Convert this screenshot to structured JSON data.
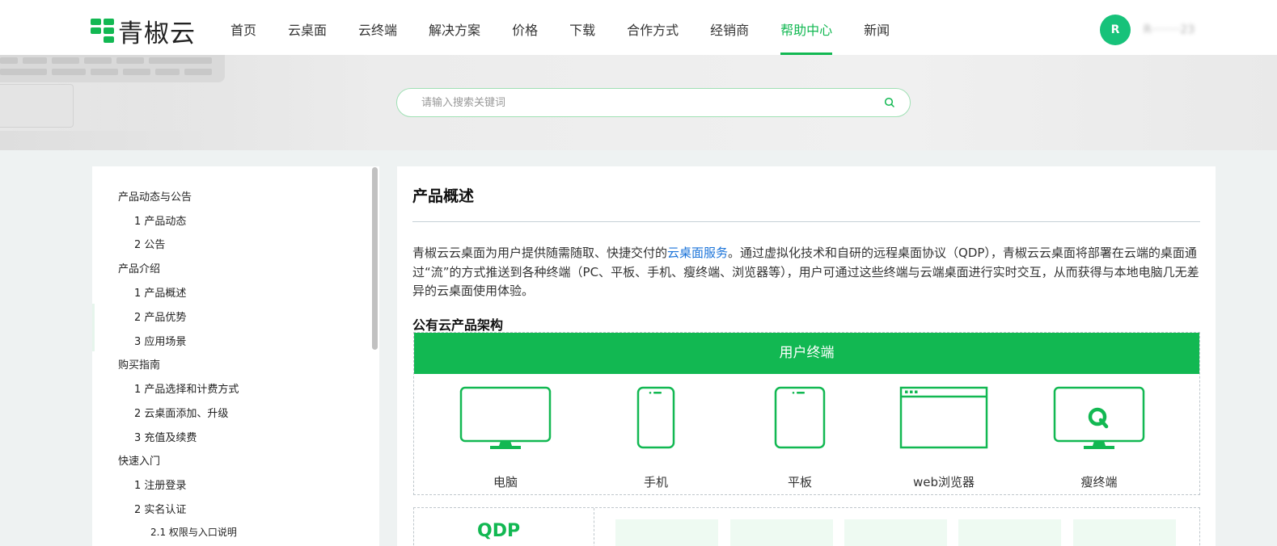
{
  "header": {
    "logo_text": "青椒云",
    "nav": [
      "首页",
      "云桌面",
      "云终端",
      "解决方案",
      "价格",
      "下载",
      "合作方式",
      "经销商",
      "帮助中心",
      "新闻"
    ],
    "active_nav": "帮助中心",
    "avatar_letter": "R",
    "username": "R········23"
  },
  "search": {
    "placeholder": "请输入搜索关键词"
  },
  "sidebar": {
    "items": [
      {
        "label": "产品动态与公告",
        "level": 1
      },
      {
        "label": "1 产品动态",
        "level": 2
      },
      {
        "label": "2 公告",
        "level": 2
      },
      {
        "label": "产品介绍",
        "level": 1
      },
      {
        "label": "1 产品概述",
        "level": 2
      },
      {
        "label": "2 产品优势",
        "level": 2
      },
      {
        "label": "3 应用场景",
        "level": 2
      },
      {
        "label": "购买指南",
        "level": 1
      },
      {
        "label": "1 产品选择和计费方式",
        "level": 2
      },
      {
        "label": "2 云桌面添加、升级",
        "level": 2
      },
      {
        "label": "3 充值及续费",
        "level": 2
      },
      {
        "label": "快速入门",
        "level": 1
      },
      {
        "label": "1 注册登录",
        "level": 2
      },
      {
        "label": "2 实名认证",
        "level": 2
      },
      {
        "label": "2.1 权限与入口说明",
        "level": 3
      }
    ]
  },
  "main": {
    "title": "产品概述",
    "intro_before": "青椒云云桌面为用户提供随需随取、快捷交付的",
    "intro_link": "云桌面服务",
    "intro_after": "。通过虚拟化技术和自研的远程桌面协议（QDP），青椒云云桌面将部署在云端的桌面通过“流”的方式推送到各种终端（PC、平板、手机、瘦终端、浏览器等），用户可通过这些终端与云端桌面进行实时交互，从而获得与本地电脑几无差异的云桌面使用体验。",
    "section_title": "公有云产品架构",
    "arch_header": "用户终端",
    "terminals": [
      "电脑",
      "手机",
      "平板",
      "web浏览器",
      "瘦终端"
    ],
    "qdp_label": "QDP"
  },
  "colors": {
    "brand": "#12b852",
    "link": "#1a73d9",
    "avatar": "#17c27a"
  }
}
